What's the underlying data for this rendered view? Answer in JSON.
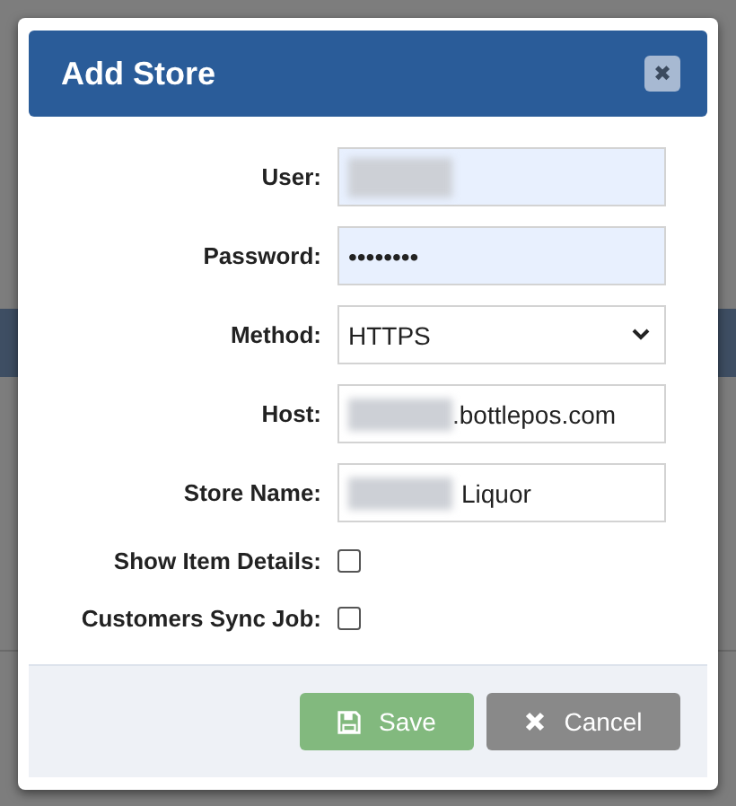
{
  "dialog": {
    "title": "Add Store",
    "close_icon_text": "✖"
  },
  "fields": [
    {
      "kind": "text",
      "label": "User:",
      "redacted": true,
      "filled": true
    },
    {
      "kind": "password",
      "label": "Password:",
      "value": "••••••••",
      "filled": true
    },
    {
      "kind": "select",
      "label": "Method:",
      "value": "HTTPS",
      "filled": false
    },
    {
      "kind": "text",
      "label": "Host:",
      "value": ".bottlepos.com",
      "redacted": true,
      "filled": false
    },
    {
      "kind": "text",
      "label": "Store Name:",
      "value": "Liquor",
      "redacted": true,
      "filled": false
    },
    {
      "kind": "checkbox",
      "label": "Show Item Details:",
      "checked": false
    },
    {
      "kind": "checkbox",
      "label": "Customers Sync Job:",
      "checked": false
    }
  ],
  "buttons": [
    {
      "kind": "save",
      "label": "Save"
    },
    {
      "kind": "cancel",
      "label": "Cancel"
    }
  ]
}
